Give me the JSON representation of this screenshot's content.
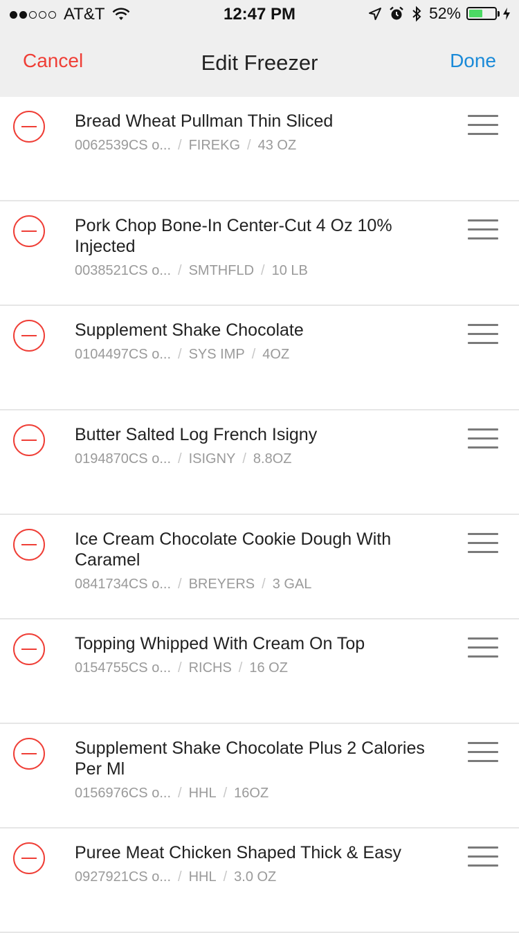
{
  "status_bar": {
    "carrier": "AT&T",
    "signal_bars_filled": 2,
    "signal_bars_total": 5,
    "time": "12:47 PM",
    "battery_percent": "52%",
    "battery_level": 0.52
  },
  "nav": {
    "cancel_label": "Cancel",
    "title": "Edit Freezer",
    "done_label": "Done"
  },
  "items": [
    {
      "name": "Bread Wheat Pullman Thin Sliced",
      "code": "0062539CS o...",
      "brand": "FIREKG",
      "size": "43 OZ"
    },
    {
      "name": "Pork Chop Bone-In Center-Cut 4 Oz 10% Injected",
      "code": "0038521CS o...",
      "brand": "SMTHFLD",
      "size": "10 LB"
    },
    {
      "name": "Supplement Shake Chocolate",
      "code": "0104497CS o...",
      "brand": "SYS IMP",
      "size": "4OZ"
    },
    {
      "name": "Butter Salted Log French Isigny",
      "code": "0194870CS o...",
      "brand": "ISIGNY",
      "size": "8.8OZ"
    },
    {
      "name": "Ice Cream Chocolate Cookie Dough With Caramel",
      "code": "0841734CS o...",
      "brand": "BREYERS",
      "size": "3 GAL"
    },
    {
      "name": "Topping Whipped With Cream On Top",
      "code": "0154755CS o...",
      "brand": "RICHS",
      "size": "16 OZ"
    },
    {
      "name": "Supplement Shake Chocolate Plus 2 Calories Per Ml",
      "code": "0156976CS o...",
      "brand": "HHL",
      "size": "16OZ"
    },
    {
      "name": "Puree Meat Chicken Shaped Thick & Easy",
      "code": "0927921CS o...",
      "brand": "HHL",
      "size": "3.0 OZ"
    }
  ],
  "colors": {
    "cancel": "#ef3e36",
    "done": "#1a8ad8",
    "delete_icon": "#ef3e36",
    "battery_fill": "#4cd964"
  }
}
